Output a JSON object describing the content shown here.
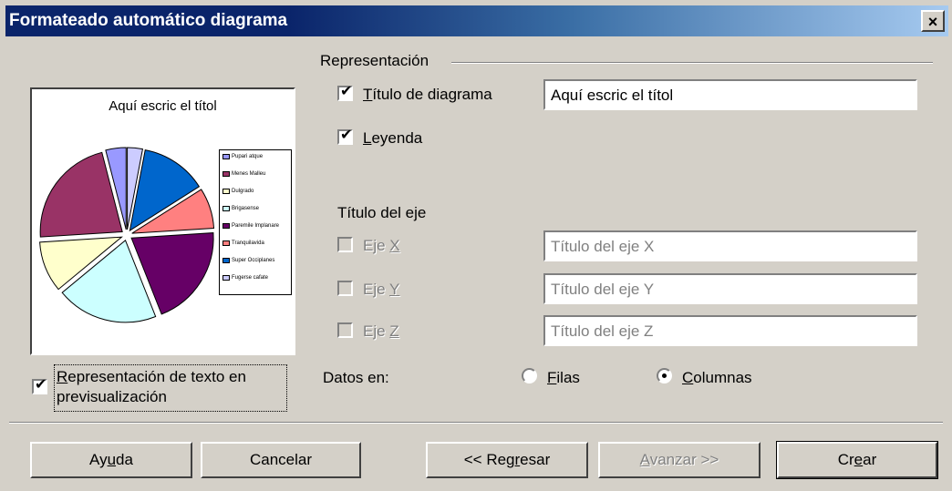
{
  "window": {
    "title": "Formateado automático diagrama",
    "close_label": "×"
  },
  "preview": {
    "chart_title": "Aquí escric el títol",
    "legend": [
      {
        "label": "Pupari atque",
        "color": "#9999ff"
      },
      {
        "label": "Menes Malleu",
        "color": "#993366"
      },
      {
        "label": "Dulgrado",
        "color": "#ffffcc"
      },
      {
        "label": "Brigasense",
        "color": "#ccffff"
      },
      {
        "label": "Paremile Implanare",
        "color": "#660066"
      },
      {
        "label": "Tranquilavida",
        "color": "#ff8080"
      },
      {
        "label": "Super Occiplanes",
        "color": "#0066cc"
      },
      {
        "label": "Fugerse cafate",
        "color": "#ccccff"
      }
    ],
    "show_text_checkbox": {
      "checked": true,
      "label_line1": "Representación de texto en",
      "label_line2": "previsualización",
      "accel": "R"
    }
  },
  "representacion": {
    "group_label": "Representación",
    "titulo_diagrama": {
      "checked": true,
      "label_accel": "T",
      "label_rest": "ítulo de diagrama",
      "value": "Aquí escric el títol"
    },
    "leyenda": {
      "checked": true,
      "label_accel": "L",
      "label_rest": "eyenda"
    }
  },
  "titulo_eje": {
    "label": "Título del eje",
    "x": {
      "checked": false,
      "label_prefix": "Eje ",
      "label_accel": "X",
      "value": "Título del eje X"
    },
    "y": {
      "checked": false,
      "label_prefix": "Eje ",
      "label_accel": "Y",
      "value": "Título del eje Y"
    },
    "z": {
      "checked": false,
      "label_prefix": "Eje ",
      "label_accel": "Z",
      "value": "Título del eje Z"
    }
  },
  "datos_en": {
    "label": "Datos en:",
    "filas": {
      "selected": false,
      "label_accel": "F",
      "label_rest": "ilas"
    },
    "columnas": {
      "selected": true,
      "label_accel": "C",
      "label_rest": "olumnas"
    }
  },
  "buttons": {
    "ayuda": {
      "pre": "Ay",
      "accel": "u",
      "post": "da"
    },
    "cancelar": "Cancelar",
    "regresar": {
      "pre": "<< Reg",
      "accel": "r",
      "post": "esar"
    },
    "avanzar": {
      "accel": "A",
      "post": "vanzar >>",
      "enabled": false
    },
    "crear": {
      "pre": "Cr",
      "accel": "e",
      "post": "ar"
    }
  },
  "chart_data": {
    "type": "pie",
    "title": "Aquí escric el títol",
    "categories": [
      "Pupari atque",
      "Menes Malleu",
      "Dulgrado",
      "Brigasense",
      "Paremile Implanare",
      "Tranquilavida",
      "Super Occiplanes",
      "Fugerse cafate"
    ],
    "values": [
      3,
      13,
      8,
      20,
      20,
      10,
      22,
      4
    ],
    "colors": [
      "#ccccff",
      "#0066cc",
      "#ff8080",
      "#660066",
      "#ccffff",
      "#ffffcc",
      "#993366",
      "#9999ff"
    ]
  }
}
